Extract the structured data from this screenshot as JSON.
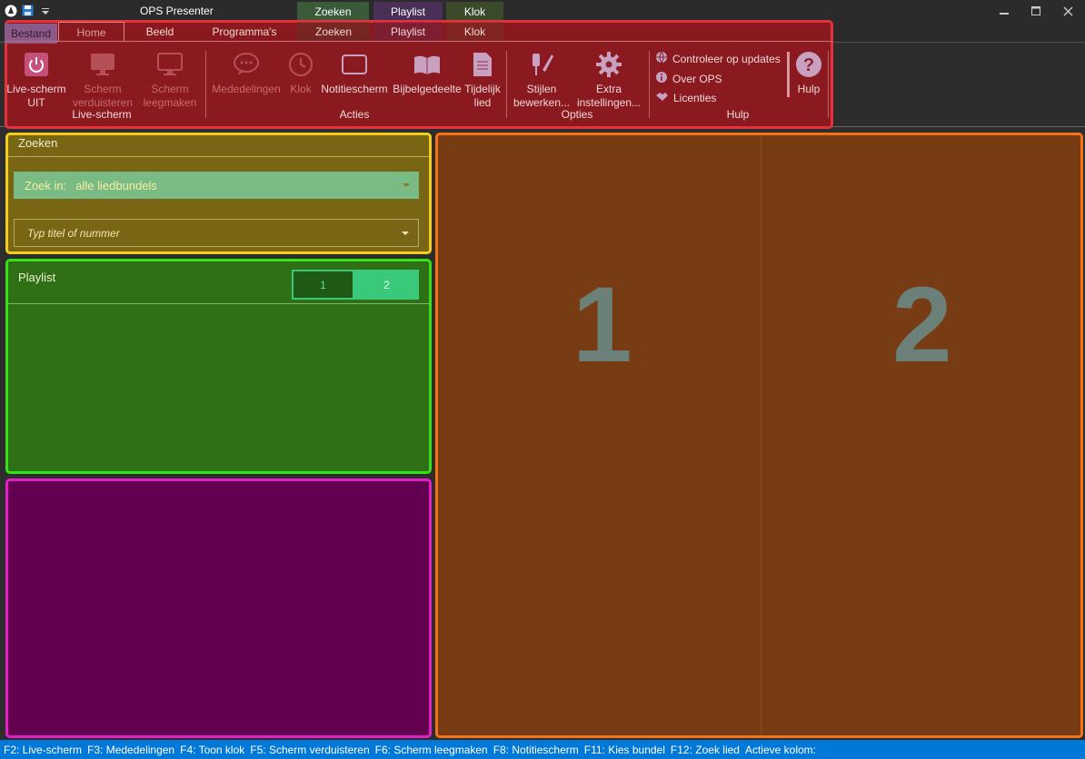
{
  "title_bar": {
    "app_title": "OPS Presenter",
    "context_tabs": [
      "Zoeken",
      "Playlist",
      "Klok"
    ]
  },
  "ribbon": {
    "file_tab": "Bestand",
    "tabs": [
      "Home",
      "Beeld",
      "Programma's",
      "Zoeken",
      "Playlist",
      "Klok"
    ],
    "groups": {
      "live_screen": {
        "label": "Live-scherm",
        "buttons": [
          {
            "label_1": "Live-scherm",
            "label_2": "UIT",
            "icon": "power-icon"
          },
          {
            "label_1": "Scherm",
            "label_2": "verduisteren",
            "icon": "monitor-icon"
          },
          {
            "label_1": "Scherm",
            "label_2": "leegmaken",
            "icon": "monitor-icon"
          }
        ]
      },
      "actions": {
        "label": "Acties",
        "buttons": [
          {
            "label_1": "Mededelingen",
            "icon": "speech-bubble-icon"
          },
          {
            "label_1": "Klok",
            "icon": "clock-icon"
          },
          {
            "label_1": "Notitiescherm",
            "icon": "screen-icon"
          },
          {
            "label_1": "Bijbelgedeelte",
            "icon": "book-icon"
          },
          {
            "label_1": "Tijdelijk",
            "label_2": "lied",
            "icon": "document-icon"
          }
        ]
      },
      "options": {
        "label": "Opties",
        "buttons": [
          {
            "label_1": "Stijlen",
            "label_2": "bewerken...",
            "icon": "brush-icon"
          },
          {
            "label_1": "Extra",
            "label_2": "instellingen...",
            "icon": "gear-icon"
          }
        ]
      },
      "help": {
        "label": "Hulp",
        "items": [
          {
            "label": "Controleer op updates",
            "icon": "globe-icon"
          },
          {
            "label": "Over OPS",
            "icon": "info-icon"
          },
          {
            "label": "Licenties",
            "icon": "handshake-icon"
          }
        ],
        "help_button": {
          "label": "Hulp",
          "icon": "question-icon"
        }
      }
    }
  },
  "search_panel": {
    "title": "Zoeken",
    "search_in_label": "Zoek in:",
    "search_in_value": "alle liedbundels",
    "input_placeholder": "Typ titel of nummer"
  },
  "playlist_panel": {
    "title": "Playlist",
    "columns": [
      "1",
      "2"
    ]
  },
  "preview": {
    "columns": [
      "1",
      "2"
    ]
  },
  "status_bar": {
    "shortcuts": [
      "F2: Live-scherm",
      "F3: Mededelingen",
      "F4: Toon klok",
      "F5: Scherm verduisteren",
      "F6: Scherm leegmaken",
      "F8: Notitiescherm",
      "F11: Kies bundel",
      "F12: Zoek lied",
      "Actieve kolom:"
    ]
  },
  "colors": {
    "ribbon_overlay": "#e5323a",
    "search_overlay": "#f5cc1a",
    "playlist_overlay": "#35e214",
    "magenta_overlay": "#e61ec8",
    "preview_overlay": "#f57314",
    "status_bar": "#0078d7"
  }
}
